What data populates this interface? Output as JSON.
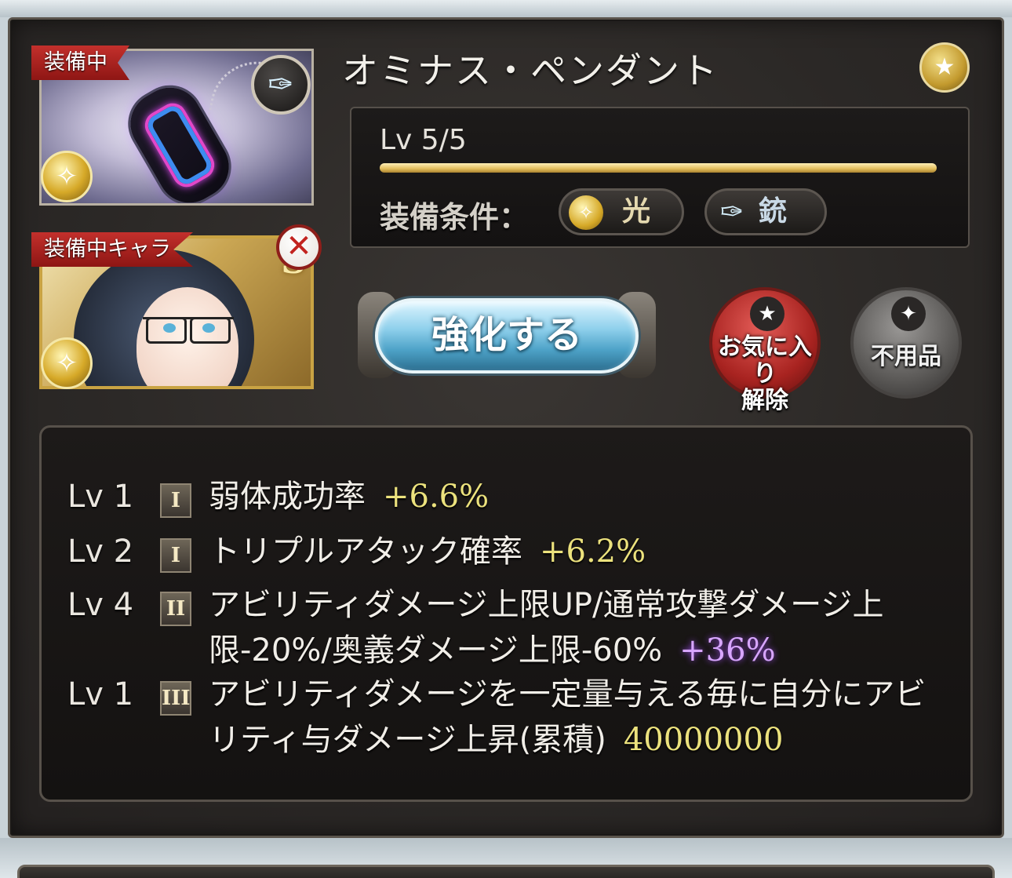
{
  "item": {
    "name": "オミナス・ペンダント",
    "equipped_tag": "装備中",
    "equipped_chara_tag": "装備中キャラ",
    "level_text": "Lv 5/5",
    "level_fraction": 1.0
  },
  "conditions": {
    "label": "装備条件：",
    "element": "光",
    "weapon_type": "銃"
  },
  "actions": {
    "enhance": "強化する",
    "unfavorite_line1": "お気に入り",
    "unfavorite_line2": "解除",
    "junk": "不用品"
  },
  "skills": [
    {
      "lv": "Lv 1",
      "tier": "I",
      "text": "弱体成功率",
      "value": "+6.6%",
      "value_color": "yellow"
    },
    {
      "lv": "Lv 2",
      "tier": "I",
      "text": "トリプルアタック確率",
      "value": "+6.2%",
      "value_color": "yellow"
    },
    {
      "lv": "Lv 4",
      "tier": "II",
      "text": "アビリティダメージ上限UP/通常攻撃ダメージ上限-20%/奥義ダメージ上限-60%",
      "value": "+36%",
      "value_color": "purple"
    },
    {
      "lv": "Lv 1",
      "tier": "III",
      "text": "アビリティダメージを一定量与える毎に自分にアビリティ与ダメージ上昇(累積)",
      "value": "40000000",
      "value_color": "yellow"
    }
  ],
  "character": {
    "rank_letter": "S"
  },
  "colors": {
    "tag_red": "#c3302c",
    "level_bar_gold": "#e2bd5b",
    "value_yellow": "#ece27d",
    "value_purple": "#d8a6ff",
    "enhance_blue": "#8fd0ec"
  },
  "icons": {
    "weapon_badge": "gun-icon",
    "element_badge": "light-element-icon",
    "favorite_badge": "star-icon",
    "remove_badge": "close-icon",
    "junk": "sparkle-icon"
  }
}
